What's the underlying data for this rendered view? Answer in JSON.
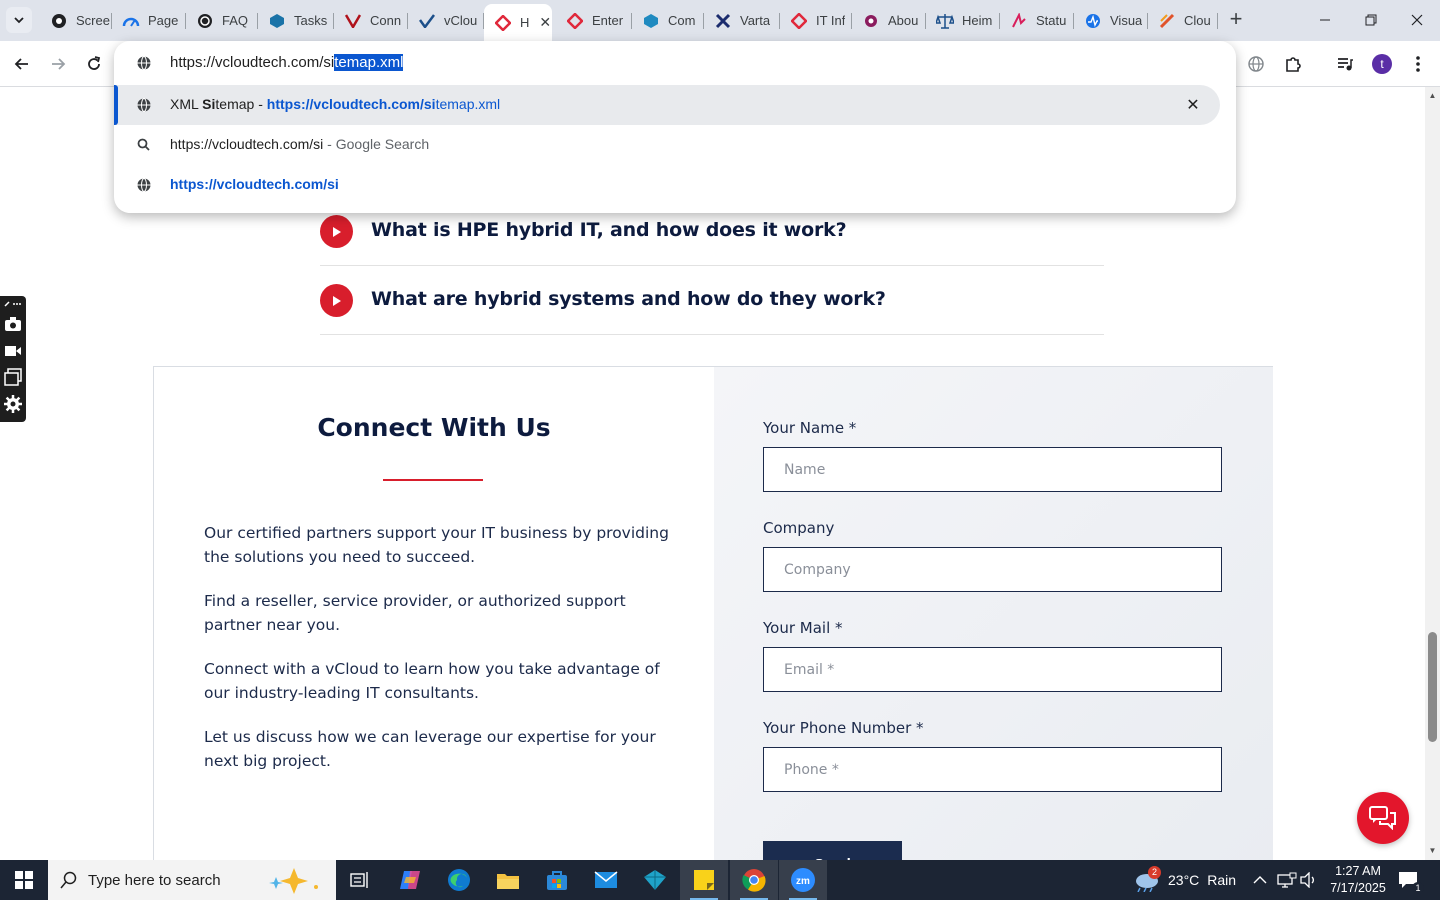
{
  "browser": {
    "tabs": [
      {
        "label": "Scree",
        "icon": "screenshot-app-icon"
      },
      {
        "label": "Page",
        "icon": "pagespeed-icon"
      },
      {
        "label": "FAQ",
        "icon": "faq-site-icon"
      },
      {
        "label": "Tasks",
        "icon": "tasks-icon"
      },
      {
        "label": "Conn",
        "icon": "v-logo-icon"
      },
      {
        "label": "vClou",
        "icon": "vcloud-icon"
      },
      {
        "label": "H",
        "icon": "hpe-diamond-icon",
        "active": true
      },
      {
        "label": "Enter",
        "icon": "hpe-diamond-icon"
      },
      {
        "label": "Com",
        "icon": "hexagon-icon"
      },
      {
        "label": "Varta",
        "icon": "x-logo-icon"
      },
      {
        "label": "IT Inf",
        "icon": "hpe-diamond-icon"
      },
      {
        "label": "Abou",
        "icon": "purple-logo-icon"
      },
      {
        "label": "Heim",
        "icon": "scales-icon"
      },
      {
        "label": "Statu",
        "icon": "status-icon"
      },
      {
        "label": "Visua",
        "icon": "wave-icon"
      },
      {
        "label": "Clou",
        "icon": "slash-icon"
      }
    ],
    "new_tab": "+",
    "profile_initial": "t",
    "omnibox": {
      "typed": "https://vcloudtech.com/si",
      "completion": "temap.xml",
      "suggestions": [
        {
          "prefix": "XML ",
          "match_bold": "Si",
          "rest": "temap",
          "sep": " - ",
          "url_bold": "https://vcloudtech.com/si",
          "url_rest": "temap.xml",
          "selected": true
        },
        {
          "text": "https://vcloudtech.com/si",
          "suffix": " - Google Search"
        },
        {
          "url_bold": "https://vcloudtech.com/si"
        }
      ]
    }
  },
  "page": {
    "faqs": [
      "What is HPE hybrid IT, and how does it work?",
      "What are hybrid systems and how do they work?"
    ],
    "contact": {
      "title": "Connect With Us",
      "paragraphs": [
        "Our certified partners support your IT business by providing the solutions you need to succeed.",
        "Find a reseller, service provider, or authorized support partner near you.",
        "Connect with a vCloud to learn how you take advantage of our industry-leading IT consultants.",
        "Let us discuss how we can leverage our expertise for your next big project."
      ],
      "form": {
        "name_label": "Your Name *",
        "name_placeholder": "Name",
        "company_label": "Company",
        "company_placeholder": "Company",
        "mail_label": "Your Mail *",
        "mail_placeholder": "Email *",
        "phone_label": "Your Phone Number *",
        "phone_placeholder": "Phone *",
        "submit_label": "Send"
      }
    }
  },
  "taskbar": {
    "search_placeholder": "Type here to search",
    "weather_temp": "23°C",
    "weather_desc": "Rain",
    "weather_badge": "2",
    "time": "1:27 AM",
    "date": "7/17/2025",
    "notification_count": "1"
  },
  "colors": {
    "accent_red": "#d81e2c",
    "navy": "#0d1b3e",
    "chrome_blue": "#0b57d0"
  }
}
